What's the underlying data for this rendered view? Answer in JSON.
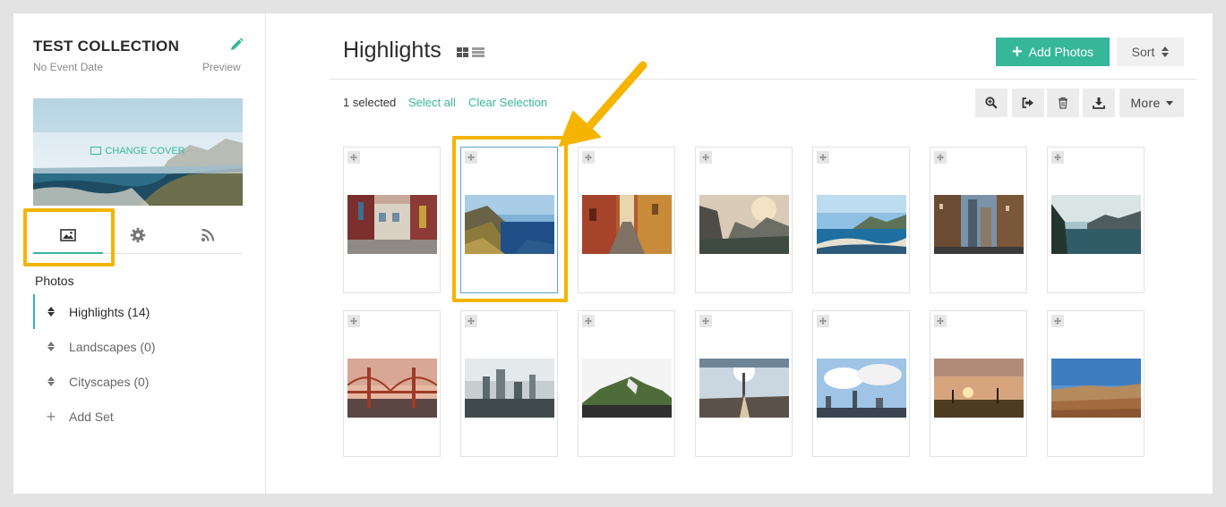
{
  "sidebar": {
    "collection_title": "TEST COLLECTION",
    "event_date": "No Event Date",
    "preview_link": "Preview",
    "change_cover": "CHANGE COVER",
    "tabs": [
      {
        "icon": "image-icon",
        "active": true
      },
      {
        "icon": "gear-icon",
        "active": false
      },
      {
        "icon": "rss-icon",
        "active": false
      }
    ],
    "photos_heading": "Photos",
    "sets": [
      {
        "label": "Highlights (14)",
        "active": true
      },
      {
        "label": "Landscapes (0)",
        "active": false
      },
      {
        "label": "Cityscapes (0)",
        "active": false
      }
    ],
    "add_set": "Add Set"
  },
  "main": {
    "title": "Highlights",
    "add_photos": "Add Photos",
    "sort": "Sort",
    "selected_count": "1 selected",
    "select_all": "Select all",
    "clear_selection": "Clear Selection",
    "toolbar": {
      "icons": [
        "zoom-in-icon",
        "share-icon",
        "trash-icon",
        "download-icon"
      ],
      "more": "More"
    },
    "photos": [
      {
        "subject": "colorful street",
        "selected": false
      },
      {
        "subject": "coastal cliffs",
        "selected": true
      },
      {
        "subject": "narrow alley",
        "selected": false
      },
      {
        "subject": "misty valley",
        "selected": false
      },
      {
        "subject": "beach bay",
        "selected": false
      },
      {
        "subject": "city buildings",
        "selected": false
      },
      {
        "subject": "lake mountains",
        "selected": false
      },
      {
        "subject": "golden gate bridge",
        "selected": false
      },
      {
        "subject": "foggy skyline",
        "selected": false
      },
      {
        "subject": "green hill",
        "selected": false
      },
      {
        "subject": "paris sunburst",
        "selected": false
      },
      {
        "subject": "city under clouds",
        "selected": false
      },
      {
        "subject": "sunset field",
        "selected": false
      },
      {
        "subject": "desert plain",
        "selected": false
      }
    ]
  },
  "colors": {
    "accent": "#37b79a",
    "highlight": "#f4b400",
    "selected_border": "#5aa6c8"
  }
}
